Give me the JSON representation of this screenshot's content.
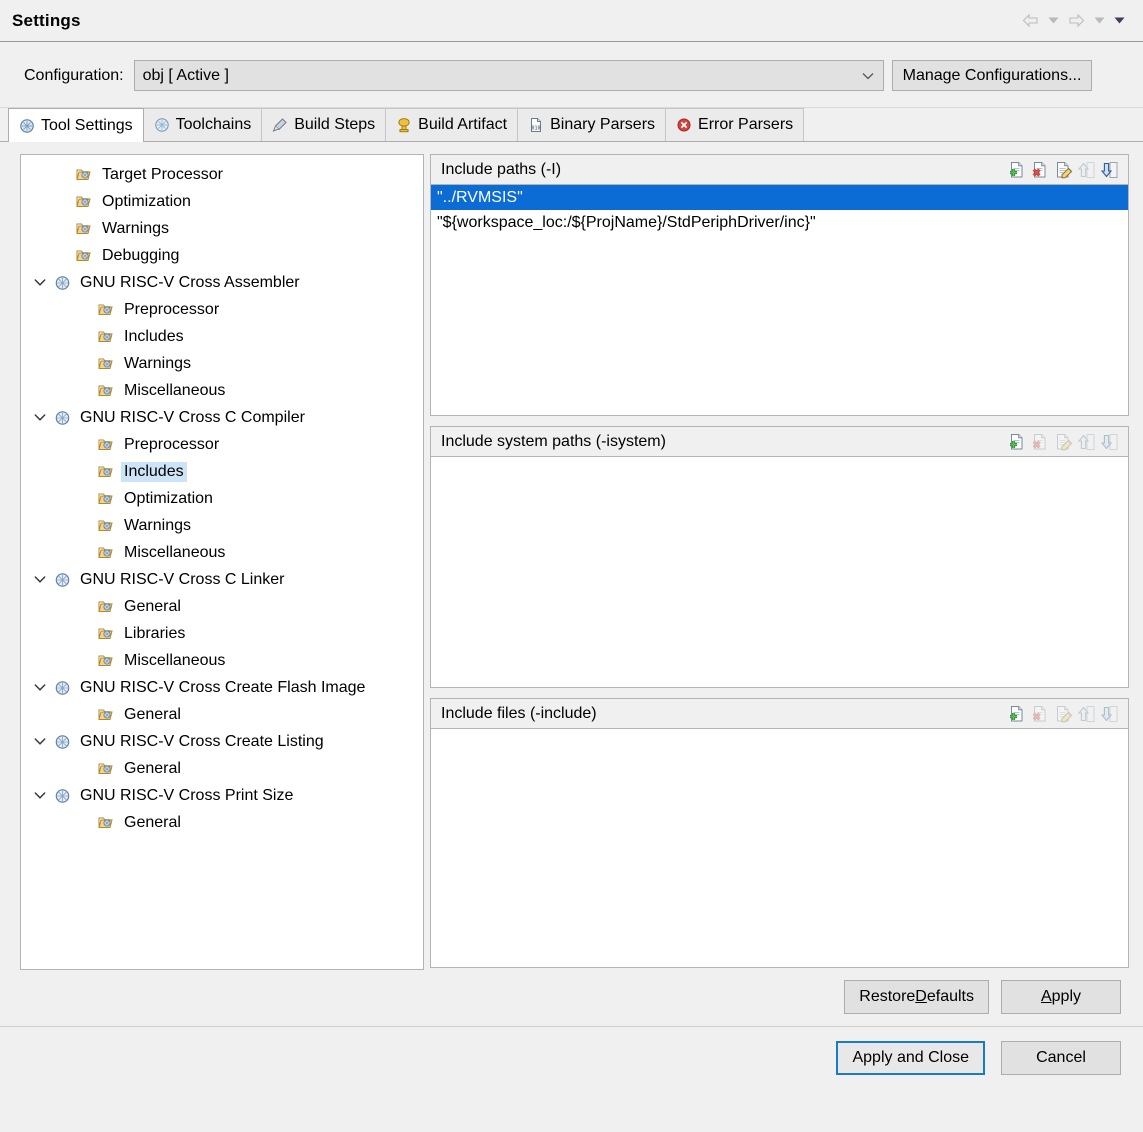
{
  "window": {
    "title": "Settings",
    "nav": [
      {
        "name": "back-arrow-icon",
        "label": "Back"
      },
      {
        "name": "back-dropdown-icon",
        "label": "Back history"
      },
      {
        "name": "forward-arrow-icon",
        "label": "Forward"
      },
      {
        "name": "forward-dropdown-icon",
        "label": "Forward history"
      },
      {
        "name": "menu-dropdown-icon",
        "label": "Menu"
      }
    ]
  },
  "config": {
    "label": "Configuration:",
    "value": "obj  [ Active ]",
    "options": [
      "obj  [ Active ]"
    ],
    "manage_button": "Manage Configurations..."
  },
  "tabs": [
    {
      "label": "Tool Settings",
      "icon": "tool-settings-icon",
      "active": true
    },
    {
      "label": "Toolchains",
      "icon": "toolchains-icon",
      "active": false
    },
    {
      "label": "Build Steps",
      "icon": "build-steps-icon",
      "active": false
    },
    {
      "label": "Build Artifact",
      "icon": "build-artifact-icon",
      "active": false
    },
    {
      "label": "Binary Parsers",
      "icon": "binary-parsers-icon",
      "active": false
    },
    {
      "label": "Error Parsers",
      "icon": "error-parsers-icon",
      "active": false
    }
  ],
  "tree": [
    {
      "label": "Target Processor",
      "indent": 1,
      "icon": "folder-icon",
      "twisty": "none",
      "selected": false
    },
    {
      "label": "Optimization",
      "indent": 1,
      "icon": "folder-icon",
      "twisty": "none",
      "selected": false
    },
    {
      "label": "Warnings",
      "indent": 1,
      "icon": "folder-icon",
      "twisty": "none",
      "selected": false
    },
    {
      "label": "Debugging",
      "indent": 1,
      "icon": "folder-icon",
      "twisty": "none",
      "selected": false
    },
    {
      "label": "GNU RISC-V Cross Assembler",
      "indent": 0,
      "icon": "tool-icon",
      "twisty": "expanded",
      "selected": false
    },
    {
      "label": "Preprocessor",
      "indent": 2,
      "icon": "folder-icon",
      "twisty": "none",
      "selected": false
    },
    {
      "label": "Includes",
      "indent": 2,
      "icon": "folder-icon",
      "twisty": "none",
      "selected": false
    },
    {
      "label": "Warnings",
      "indent": 2,
      "icon": "folder-icon",
      "twisty": "none",
      "selected": false
    },
    {
      "label": "Miscellaneous",
      "indent": 2,
      "icon": "folder-icon",
      "twisty": "none",
      "selected": false
    },
    {
      "label": "GNU RISC-V Cross C Compiler",
      "indent": 0,
      "icon": "tool-icon",
      "twisty": "expanded",
      "selected": false
    },
    {
      "label": "Preprocessor",
      "indent": 2,
      "icon": "folder-icon",
      "twisty": "none",
      "selected": false
    },
    {
      "label": "Includes",
      "indent": 2,
      "icon": "folder-icon",
      "twisty": "none",
      "selected": true
    },
    {
      "label": "Optimization",
      "indent": 2,
      "icon": "folder-icon",
      "twisty": "none",
      "selected": false
    },
    {
      "label": "Warnings",
      "indent": 2,
      "icon": "folder-icon",
      "twisty": "none",
      "selected": false
    },
    {
      "label": "Miscellaneous",
      "indent": 2,
      "icon": "folder-icon",
      "twisty": "none",
      "selected": false
    },
    {
      "label": "GNU RISC-V Cross C Linker",
      "indent": 0,
      "icon": "tool-icon",
      "twisty": "expanded",
      "selected": false
    },
    {
      "label": "General",
      "indent": 2,
      "icon": "folder-icon",
      "twisty": "none",
      "selected": false
    },
    {
      "label": "Libraries",
      "indent": 2,
      "icon": "folder-icon",
      "twisty": "none",
      "selected": false
    },
    {
      "label": "Miscellaneous",
      "indent": 2,
      "icon": "folder-icon",
      "twisty": "none",
      "selected": false
    },
    {
      "label": "GNU RISC-V Cross Create Flash Image",
      "indent": 0,
      "icon": "tool-icon",
      "twisty": "expanded",
      "selected": false
    },
    {
      "label": "General",
      "indent": 2,
      "icon": "folder-icon",
      "twisty": "none",
      "selected": false
    },
    {
      "label": "GNU RISC-V Cross Create Listing",
      "indent": 0,
      "icon": "tool-icon",
      "twisty": "expanded",
      "selected": false
    },
    {
      "label": "General",
      "indent": 2,
      "icon": "folder-icon",
      "twisty": "none",
      "selected": false
    },
    {
      "label": "GNU RISC-V Cross Print Size",
      "indent": 0,
      "icon": "tool-icon",
      "twisty": "expanded",
      "selected": false
    },
    {
      "label": "General",
      "indent": 2,
      "icon": "folder-icon",
      "twisty": "none",
      "selected": false
    }
  ],
  "groups": {
    "include_paths": {
      "title": "Include paths (-I)",
      "items": [
        {
          "value": "\"../RVMSIS\"",
          "selected": true
        },
        {
          "value": "\"${workspace_loc:/${ProjName}/StdPeriphDriver/inc}\"",
          "selected": false
        }
      ],
      "tools": [
        {
          "name": "add-icon",
          "enabled": true
        },
        {
          "name": "delete-icon",
          "enabled": true
        },
        {
          "name": "edit-icon",
          "enabled": true
        },
        {
          "name": "move-up-icon",
          "enabled": false
        },
        {
          "name": "move-down-icon",
          "enabled": true
        }
      ]
    },
    "include_system_paths": {
      "title": "Include system paths (-isystem)",
      "items": [],
      "tools": [
        {
          "name": "add-icon",
          "enabled": true
        },
        {
          "name": "delete-icon",
          "enabled": false
        },
        {
          "name": "edit-icon",
          "enabled": false
        },
        {
          "name": "move-up-icon",
          "enabled": false
        },
        {
          "name": "move-down-icon",
          "enabled": false
        }
      ]
    },
    "include_files": {
      "title": "Include files (-include)",
      "items": [],
      "tools": [
        {
          "name": "add-icon",
          "enabled": true
        },
        {
          "name": "delete-icon",
          "enabled": false
        },
        {
          "name": "edit-icon",
          "enabled": false
        },
        {
          "name": "move-up-icon",
          "enabled": false
        },
        {
          "name": "move-down-icon",
          "enabled": false
        }
      ]
    }
  },
  "buttons": {
    "restore_defaults": {
      "text": "Restore Defaults",
      "mnemonic_index": 8
    },
    "apply": {
      "text": "Apply",
      "mnemonic_index": 0
    },
    "apply_and_close": {
      "text": "Apply and Close",
      "default": true
    },
    "cancel": {
      "text": "Cancel",
      "default": false
    }
  },
  "colors": {
    "selection_blue": "#0a6cd4",
    "tree_selection": "#cde4f7",
    "dialog_bg": "#f0f0f0",
    "default_button_border": "#1a7bc4"
  }
}
